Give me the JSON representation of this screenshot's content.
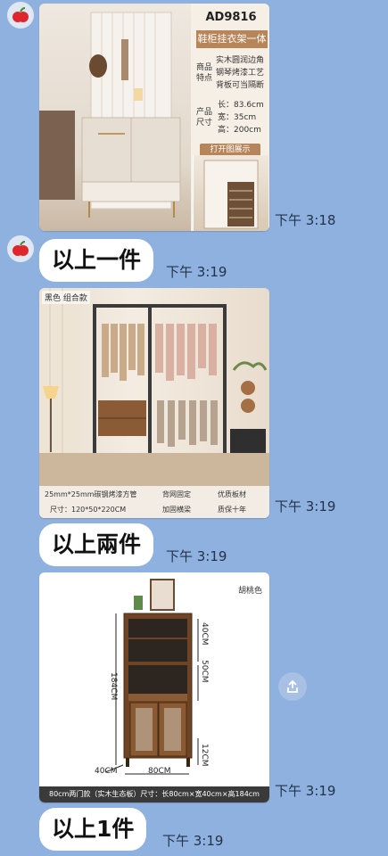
{
  "messages": [
    {
      "type": "image",
      "time": "下午 3:18",
      "product": {
        "code": "AD9816",
        "title": "鞋柜挂衣架一体",
        "feature_label_1": "商品",
        "feature_label_2": "特点",
        "features": [
          "实木圆润边角",
          "钢琴烤漆工艺",
          "背板可当隔断"
        ],
        "size_label_1": "产品",
        "size_label_2": "尺寸",
        "sizes": [
          "长：83.6cm",
          "宽：35cm",
          "高：200cm"
        ],
        "open_button": "打开图展示"
      }
    },
    {
      "type": "text",
      "text": "以上一件",
      "time": "下午 3:19"
    },
    {
      "type": "image",
      "time": "下午 3:19",
      "product": {
        "tag": "黑色  组合款",
        "feature_tube": "25mm*25mm碳钢烤漆方管",
        "feature_back": "背网固定",
        "feature_board": "优质板材",
        "size": "尺寸：120*50*220CM",
        "feature_beam": "加固横梁",
        "feature_warranty": "质保十年"
      }
    },
    {
      "type": "text",
      "text": "以上兩件",
      "time": "下午 3:19"
    },
    {
      "type": "image",
      "time": "下午 3:19",
      "product": {
        "color": "胡桃色",
        "dim_top": "40CM",
        "dim_mid": "50CM",
        "dim_height": "184CM",
        "dim_bottom": "12CM",
        "dim_depth": "40CM",
        "dim_width": "80CM",
        "caption": "80cm两门款（实木生态板）尺寸：长80cm×宽40cm×高184cm"
      }
    },
    {
      "type": "text",
      "text": "以上1件",
      "time": "下午 3:19"
    }
  ],
  "colors": {
    "chat_bg": "#8fb1df",
    "accent": "#b7855a"
  },
  "icons": {
    "avatar": "red-apple-icon",
    "share": "share-icon"
  }
}
